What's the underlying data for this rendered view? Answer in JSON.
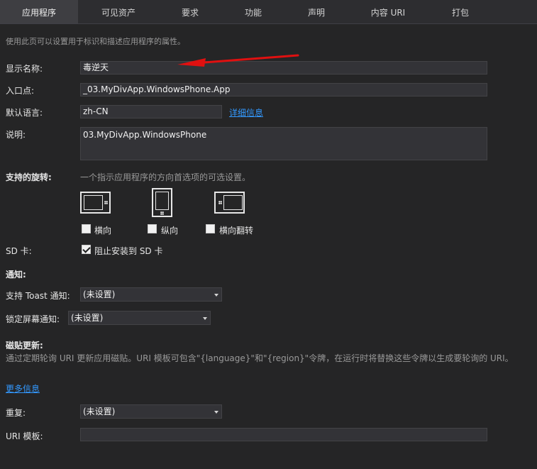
{
  "tabs": [
    {
      "label": "应用程序",
      "active": true
    },
    {
      "label": "可见资产"
    },
    {
      "label": "要求"
    },
    {
      "label": "功能"
    },
    {
      "label": "声明"
    },
    {
      "label": "内容 URI"
    },
    {
      "label": "打包"
    }
  ],
  "description": "使用此页可以设置用于标识和描述应用程序的属性。",
  "display_name": {
    "label": "显示名称:",
    "value": "毒逆天"
  },
  "entry_point": {
    "label": "入口点:",
    "value": "_03.MyDivApp.WindowsPhone.App"
  },
  "default_language": {
    "label": "默认语言:",
    "value": "zh-CN",
    "link": "详细信息"
  },
  "app_description": {
    "label": "说明:",
    "value": "03.MyDivApp.WindowsPhone"
  },
  "rotation": {
    "label": "支持的旋转:",
    "hint": "一个指示应用程序的方向首选项的可选设置。",
    "options": [
      {
        "label": "横向",
        "checked": false
      },
      {
        "label": "纵向",
        "checked": false
      },
      {
        "label": "横向翻转",
        "checked": false
      }
    ]
  },
  "sd_card": {
    "label": "SD 卡:",
    "option_label": "阻止安装到 SD 卡",
    "checked": true
  },
  "notifications": {
    "heading": "通知:",
    "toast": {
      "label": "支持 Toast 通知:",
      "value": "(未设置)"
    },
    "lock_screen": {
      "label": "锁定屏幕通知:",
      "value": "(未设置)"
    }
  },
  "tile_update": {
    "heading": "磁贴更新:",
    "hint": "通过定期轮询 URI 更新应用磁贴。URI 模板可包含\"{language}\"和\"{region}\"令牌，在运行时将替换这些令牌以生成要轮询的 URI。",
    "more_info": "更多信息",
    "recurrence": {
      "label": "重复:",
      "value": "(未设置)"
    },
    "uri_template": {
      "label": "URI 模板:",
      "value": ""
    }
  },
  "annotation": {
    "color": "#e01010"
  }
}
